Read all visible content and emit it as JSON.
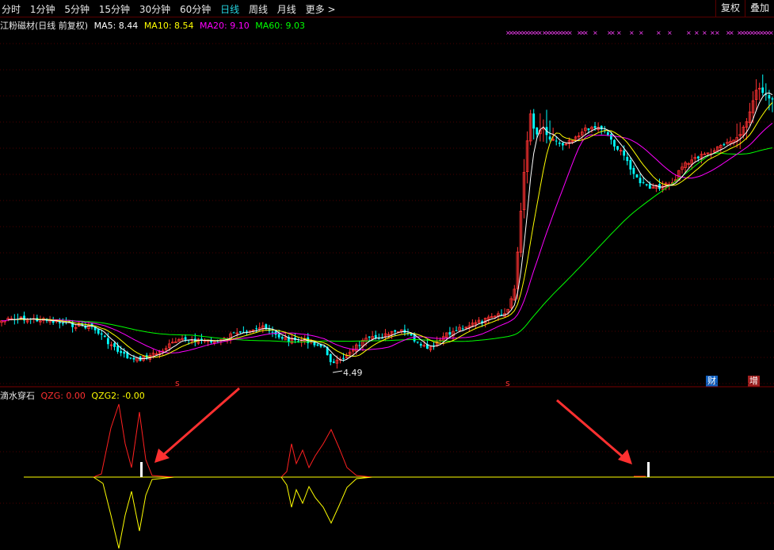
{
  "toolbar": {
    "tabs": [
      "分时",
      "1分钟",
      "5分钟",
      "15分钟",
      "30分钟",
      "60分钟",
      "日线",
      "周线",
      "月线",
      "更多 >"
    ],
    "active_tab": "日线",
    "fq_button": "复权",
    "overlay_button": "叠加"
  },
  "legend": {
    "stock_label": "江粉磁材(日线 前复权)",
    "ma5": "MA5: 8.44",
    "ma10": "MA10: 8.54",
    "ma20": "MA20: 9.10",
    "ma60": "MA60: 9.03"
  },
  "indicator": {
    "name": "滴水穿石",
    "qzg": "QZG: 0.00",
    "qzg2": "QZG2: -0.00"
  },
  "low_price_label": "4.49",
  "badges": {
    "cai": "财",
    "zeng": "增"
  },
  "colors": {
    "ma5": "#ffffff",
    "ma10": "#ffff00",
    "ma20": "#ff00ff",
    "ma60": "#00ff00",
    "up": "#ff3232",
    "down": "#00ffff",
    "qzg": "#ff2020",
    "qzg2": "#ffff00",
    "arrow": "#ff3030"
  }
}
